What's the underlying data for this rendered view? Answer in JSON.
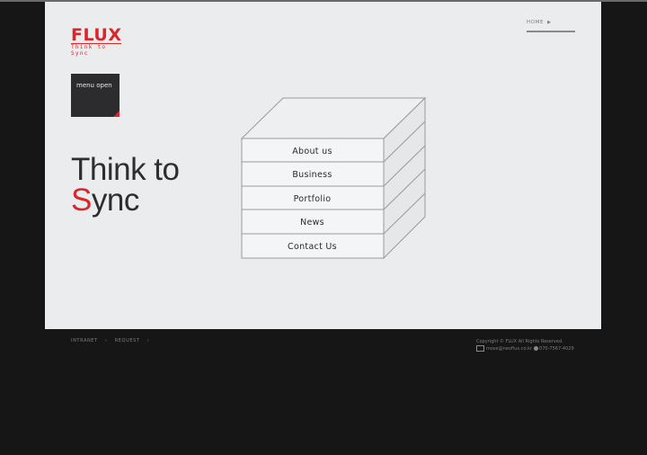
{
  "brand": {
    "logo_word": "FLUX",
    "logo_tagline": "Think to Sync"
  },
  "header": {
    "home_label": "HOME"
  },
  "menu": {
    "open_label": "menu open"
  },
  "hero": {
    "line1": "Think to",
    "line2_accent": "S",
    "line2_rest": "ync"
  },
  "cube_menu": {
    "items": [
      {
        "label": "About us"
      },
      {
        "label": "Business"
      },
      {
        "label": "Portfolio"
      },
      {
        "label": "News"
      },
      {
        "label": "Contact Us"
      }
    ]
  },
  "footer": {
    "links": [
      "INTRANET",
      "REQUEST"
    ],
    "copyright": "Copyright © FLUX All Rights Reserved.",
    "email": "mose@neoflux.co.kr",
    "phone": "070-7567-4029"
  },
  "colors": {
    "accent": "#d9262b",
    "page_bg": "#161617",
    "stage_bg": "#ebecee",
    "dark_panel": "#2c2c2e"
  }
}
